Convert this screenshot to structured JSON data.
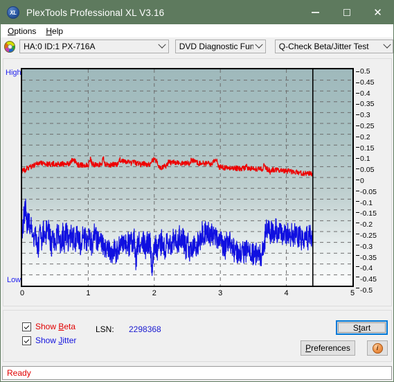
{
  "window": {
    "title": "PlexTools Professional XL V3.16",
    "icon": "xl-logo-icon",
    "minimize": "–",
    "maximize": "□",
    "close": "✕"
  },
  "menubar": {
    "items": [
      {
        "label": "Options",
        "accel": "O"
      },
      {
        "label": "Help",
        "accel": "H"
      }
    ]
  },
  "toolbar": {
    "drive_icon": "disc-icon",
    "drive_select": "HA:0 ID:1  PX-716A",
    "function_select": "DVD Diagnostic Functions",
    "test_select": "Q-Check Beta/Jitter Test"
  },
  "graph": {
    "label_high": "High",
    "label_low": "Low",
    "cursor_x": 4.4
  },
  "controls": {
    "show_beta": {
      "label_pre": "Show ",
      "label_accel": "B",
      "label_post": "eta",
      "checked": true,
      "color": "#e00000"
    },
    "show_jitter": {
      "label_pre": "Show ",
      "label_accel": "J",
      "label_post": "itter",
      "checked": true,
      "color": "#1111dd"
    },
    "lsn_label": "LSN:",
    "lsn_value": "2298368",
    "start_button": {
      "pre": "S",
      "accel": "t",
      "post": "art",
      "label": "Start"
    },
    "preferences_button": {
      "accel": "P",
      "rest": "references",
      "label": "Preferences"
    },
    "info_button": "i"
  },
  "statusbar": {
    "text": "Ready"
  },
  "chart_data": {
    "type": "line",
    "title": "Q-Check Beta/Jitter Test",
    "xlabel": "",
    "ylabel": "",
    "xlim": [
      0,
      5
    ],
    "ylim": [
      -0.5,
      0.5
    ],
    "grid": true,
    "legend_position": "bottom-left",
    "x_ticks": [
      0,
      1,
      2,
      3,
      4,
      5
    ],
    "y_ticks": [
      0.5,
      0.45,
      0.4,
      0.35,
      0.3,
      0.25,
      0.2,
      0.15,
      0.1,
      0.05,
      0,
      -0.05,
      -0.1,
      -0.15,
      -0.2,
      -0.25,
      -0.3,
      -0.35,
      -0.4,
      -0.45,
      -0.5
    ],
    "y_tick_labels": [
      "0.5",
      "0.45",
      "0.4",
      "0.35",
      "0.3",
      "0.25",
      "0.2",
      "0.15",
      "0.1",
      "0.05",
      "0",
      "-0.05",
      "-0.1",
      "-0.15",
      "-0.2",
      "-0.25",
      "-0.3",
      "-0.35",
      "-0.4",
      "-0.45",
      "-0.5"
    ],
    "x_tick_labels": [
      "0",
      "1",
      "2",
      "3",
      "4",
      "5"
    ],
    "cursor_line_x": 4.4,
    "series": [
      {
        "name": "Beta",
        "color": "#ee0000",
        "x_start": 0.0,
        "x_end": 4.4,
        "values": [
          0.03,
          0.038,
          0.028,
          0.045,
          0.04,
          0.052,
          0.048,
          0.055,
          0.058,
          0.062,
          0.065,
          0.07,
          0.068,
          0.064,
          0.066,
          0.062,
          0.06,
          0.063,
          0.061,
          0.064,
          0.062,
          0.06,
          0.063,
          0.062,
          0.061,
          0.063,
          0.06,
          0.062,
          0.064,
          0.062,
          0.075,
          0.078,
          0.076,
          0.074,
          0.06,
          0.058,
          0.056,
          0.058,
          0.057,
          0.059,
          0.058,
          0.06,
          0.09,
          0.062,
          0.06,
          0.058,
          0.057,
          0.059,
          0.06,
          0.058,
          0.098,
          0.06,
          0.058,
          0.06,
          0.059,
          0.058,
          0.06,
          0.059,
          0.058,
          0.06,
          0.085,
          0.078,
          0.076,
          0.074,
          0.072,
          0.07,
          0.068,
          0.066,
          0.068,
          0.07,
          0.066,
          0.064,
          0.062,
          0.06,
          0.062,
          0.064,
          0.06,
          0.058,
          0.06,
          0.062,
          0.08,
          0.082,
          0.078,
          0.076,
          0.05,
          0.046,
          0.048,
          0.05,
          0.052,
          0.054,
          0.072,
          0.07,
          0.068,
          0.07,
          0.069,
          0.068,
          0.07,
          0.068,
          0.066,
          0.064,
          0.066,
          0.068,
          0.066,
          0.064,
          0.078,
          0.08,
          0.076,
          0.072,
          0.068,
          0.066,
          0.064,
          0.066,
          0.065,
          0.064,
          0.063,
          0.066,
          0.064,
          0.062,
          0.08,
          0.082,
          0.078,
          0.05,
          0.048,
          0.047,
          0.046,
          0.045,
          0.044,
          0.046,
          0.044,
          0.043,
          0.042,
          0.044,
          0.043,
          0.042,
          0.041,
          0.043,
          0.042,
          0.04,
          0.06,
          0.042,
          0.041,
          0.04,
          0.042,
          0.041,
          0.04,
          0.039,
          0.041,
          0.04,
          0.038,
          0.06,
          0.04,
          0.038,
          0.037,
          0.02,
          0.038,
          0.036,
          0.035,
          0.034,
          0.036,
          0.034,
          0.033,
          0.032,
          0.031,
          0.03,
          0.029,
          0.028,
          0.027,
          0.026,
          0.025,
          0.024,
          0.023,
          0.022,
          0.021,
          0.02,
          0.019,
          0.018,
          0.017,
          0.018,
          0.016,
          0.015
        ]
      },
      {
        "name": "Jitter",
        "color": "#1010e0",
        "x_start": 0.0,
        "x_end": 4.4,
        "values": [
          -0.25,
          -0.19,
          -0.14,
          -0.21,
          -0.18,
          -0.26,
          -0.22,
          -0.3,
          -0.25,
          -0.28,
          -0.33,
          -0.27,
          -0.31,
          -0.24,
          -0.29,
          -0.25,
          -0.23,
          -0.27,
          -0.32,
          -0.26,
          -0.3,
          -0.28,
          -0.25,
          -0.29,
          -0.31,
          -0.265,
          -0.295,
          -0.255,
          -0.285,
          -0.305,
          -0.26,
          -0.29,
          -0.27,
          -0.3,
          -0.255,
          -0.285,
          -0.31,
          -0.265,
          -0.295,
          -0.275,
          -0.3,
          -0.26,
          -0.29,
          -0.32,
          -0.27,
          -0.25,
          -0.285,
          -0.3,
          -0.265,
          -0.295,
          -0.33,
          -0.34,
          -0.345,
          -0.335,
          -0.35,
          -0.34,
          -0.345,
          -0.33,
          -0.35,
          -0.345,
          -0.3,
          -0.28,
          -0.31,
          -0.27,
          -0.3,
          -0.29,
          -0.32,
          -0.28,
          -0.305,
          -0.285,
          -0.39,
          -0.32,
          -0.3,
          -0.33,
          -0.31,
          -0.295,
          -0.325,
          -0.305,
          -0.29,
          -0.315,
          -0.43,
          -0.33,
          -0.31,
          -0.34,
          -0.3,
          -0.32,
          -0.29,
          -0.315,
          -0.335,
          -0.3,
          -0.31,
          -0.29,
          -0.32,
          -0.275,
          -0.3,
          -0.285,
          -0.31,
          -0.27,
          -0.295,
          -0.28,
          -0.31,
          -0.33,
          -0.3,
          -0.34,
          -0.32,
          -0.345,
          -0.315,
          -0.335,
          -0.305,
          -0.33,
          -0.27,
          -0.25,
          -0.28,
          -0.245,
          -0.27,
          -0.255,
          -0.285,
          -0.25,
          -0.275,
          -0.26,
          -0.29,
          -0.31,
          -0.28,
          -0.32,
          -0.3,
          -0.33,
          -0.295,
          -0.315,
          -0.29,
          -0.31,
          -0.33,
          -0.35,
          -0.34,
          -0.36,
          -0.345,
          -0.355,
          -0.335,
          -0.35,
          -0.34,
          -0.355,
          -0.35,
          -0.345,
          -0.36,
          -0.34,
          -0.355,
          -0.345,
          -0.35,
          -0.36,
          -0.345,
          -0.355,
          -0.23,
          -0.25,
          -0.235,
          -0.26,
          -0.24,
          -0.255,
          -0.23,
          -0.25,
          -0.245,
          -0.26,
          -0.27,
          -0.255,
          -0.275,
          -0.25,
          -0.265,
          -0.28,
          -0.255,
          -0.27,
          -0.26,
          -0.275,
          -0.28,
          -0.265,
          -0.285,
          -0.27,
          -0.29,
          -0.275,
          -0.285,
          -0.27,
          -0.28,
          -0.29
        ]
      }
    ]
  }
}
